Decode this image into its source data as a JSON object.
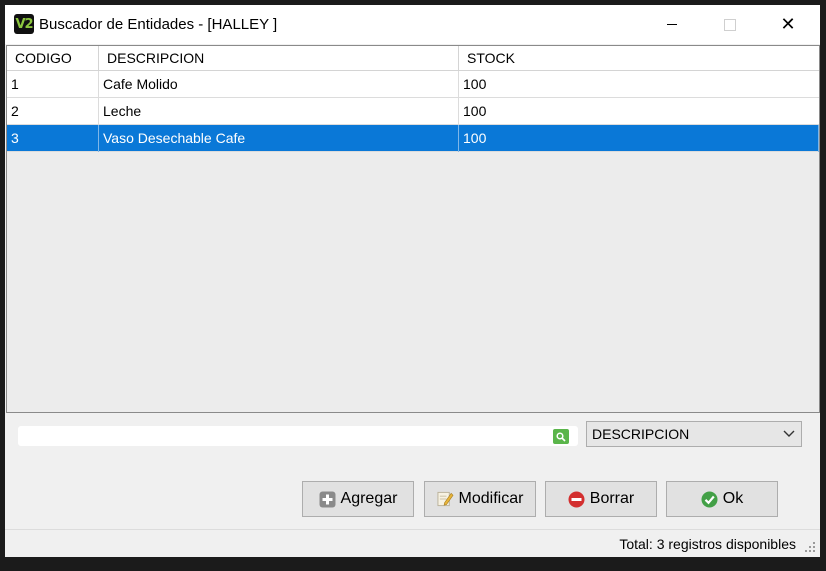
{
  "window": {
    "title": "Buscador de Entidades - [HALLEY ]",
    "app_icon_text": "V2"
  },
  "grid": {
    "columns": [
      "CODIGO",
      "DESCRIPCION",
      "STOCK"
    ],
    "rows": [
      {
        "codigo": "1",
        "descripcion": "Cafe Molido",
        "stock": "100"
      },
      {
        "codigo": "2",
        "descripcion": "Leche",
        "stock": "100"
      },
      {
        "codigo": "3",
        "descripcion": "Vaso Desechable Cafe",
        "stock": "100"
      }
    ],
    "selected_row": 3
  },
  "search": {
    "value": "",
    "field_selected": "DESCRIPCION"
  },
  "buttons": {
    "agregar": "Agregar",
    "modificar": "Modificar",
    "borrar": "Borrar",
    "ok": "Ok"
  },
  "status": {
    "text": "Total: 3 registros disponibles"
  },
  "colors": {
    "selection": "#0a78d7",
    "search_icon": "#5ab54a",
    "add_icon": "#8a8a8a",
    "delete_icon": "#d32f2f",
    "ok_icon": "#43a047",
    "brand": "#8cc63f"
  },
  "icons": {
    "app": "v2-logo-icon",
    "search": "search-icon",
    "add": "plus-icon",
    "edit": "edit-icon",
    "delete": "minus-circle-icon",
    "ok": "check-circle-icon",
    "dropdown": "chevron-down-icon"
  }
}
